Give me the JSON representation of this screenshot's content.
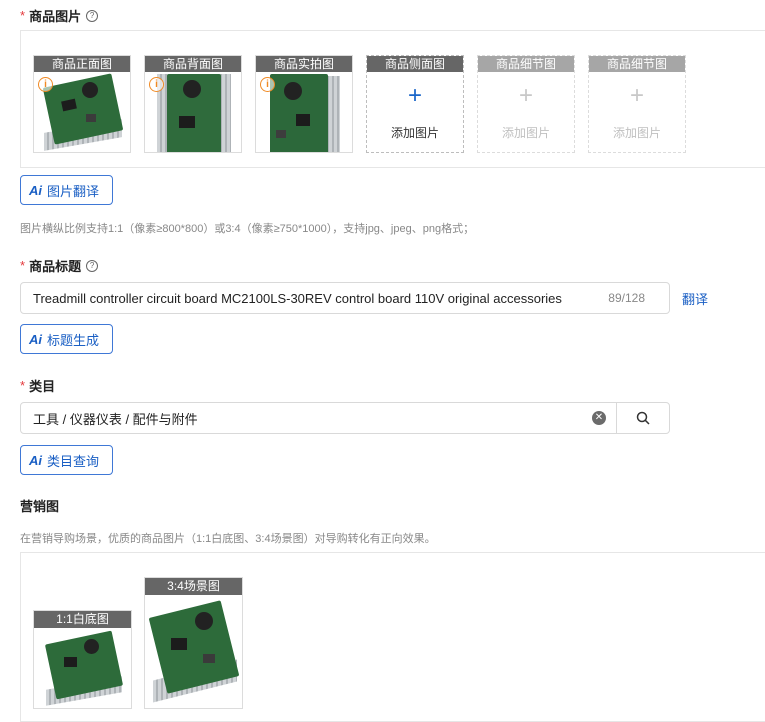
{
  "product_images": {
    "label": "商品图片",
    "help": "?",
    "slots": [
      {
        "caption": "商品正面图",
        "has_image": true,
        "warning": true
      },
      {
        "caption": "商品背面图",
        "has_image": true,
        "warning": true
      },
      {
        "caption": "商品实拍图",
        "has_image": true,
        "warning": true
      },
      {
        "caption": "商品侧面图",
        "has_image": false,
        "add_text": "添加图片"
      },
      {
        "caption": "商品细节图",
        "has_image": false,
        "add_text": "添加图片"
      },
      {
        "caption": "商品细节图",
        "has_image": false,
        "add_text": "添加图片"
      }
    ],
    "ai_button": "图片翻译",
    "hint": "图片横纵比例支持1:1（像素≥800*800）或3:4（像素≥750*1000），支持jpg、jpeg、png格式；"
  },
  "title_field": {
    "label": "商品标题",
    "help": "?",
    "value": "Treadmill controller circuit board MC2100LS-30REV control board 110V original accessories",
    "counter": "89/128",
    "translate_link": "翻译",
    "ai_button": "标题生成"
  },
  "category_field": {
    "label": "类目",
    "value": "工具 / 仪器仪表 / 配件与附件",
    "clear_icon": "clear-icon",
    "search_icon": "search-icon",
    "ai_button": "类目查询"
  },
  "marketing": {
    "label": "营销图",
    "hint": "在营销导购场景，优质的商品图片（1:1白底图、3:4场景图）对导购转化有正向效果。",
    "slots": [
      {
        "caption": "1:1白底图"
      },
      {
        "caption": "3:4场景图"
      }
    ]
  },
  "ai_icon_text": "Ai",
  "plus_glyph": "+",
  "warning_glyph": "i",
  "colors": {
    "required_star": "#e4393c",
    "accent": "#1a5fc4",
    "warning": "#f08a24",
    "caption_bg": "#666666"
  }
}
